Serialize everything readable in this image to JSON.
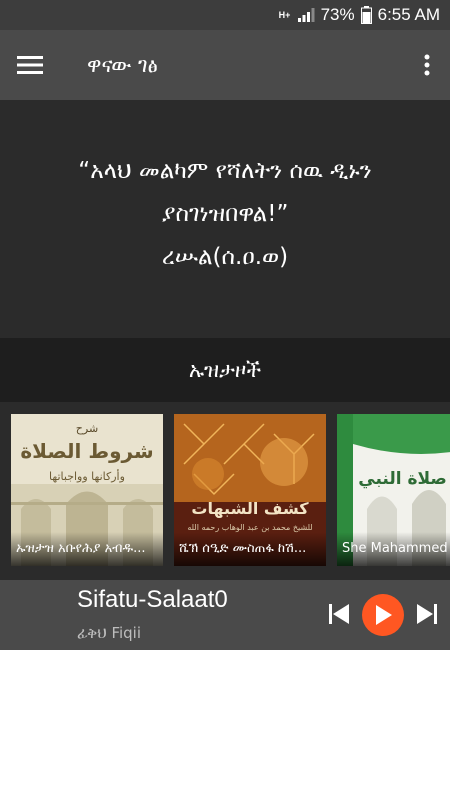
{
  "status_bar": {
    "network_type": "H+",
    "network_indicator": "4G",
    "battery": "73%",
    "time": "6:55 AM",
    "icons": [
      "signal-icon",
      "battery-icon"
    ]
  },
  "app_bar": {
    "title": "ዋናው ገፅ",
    "menu_icon": "hamburger-menu-icon",
    "more_icon": "more-vert-icon"
  },
  "quote": {
    "line1": "“አላህ መልካም የሻለትን ሰዉ ዲኑን",
    "line2": "ያስገነዝበዋል!”",
    "line3": "ረሡል(ሰ.ዐ.ወ)"
  },
  "section": {
    "title": "ኡዝታዞች"
  },
  "albums": [
    {
      "label": "ኡዝታዝ አቡየሕያ አብዱ..."
    },
    {
      "label": "ሼኽ ሰዒድ ሙስጠፋ ከሽ..."
    },
    {
      "label": "She Mahammed"
    }
  ],
  "album_art_text": {
    "a1_top": "شرح",
    "a1_main": "شروط الصلاة",
    "a1_sub": "وأركانها وواجباتها",
    "a2_title": "كشف الشبهات",
    "a2_author": "للشيخ محمد بن عبد الوهاب رحمه الله",
    "a3_title": "صفة صلاة النبي"
  },
  "player": {
    "title": "Sifatu-Salaat0",
    "subtitle": "ፊቅህ Fiqii",
    "icons": [
      "skip-previous-icon",
      "play-icon",
      "skip-next-icon"
    ],
    "accent_color": "#ff5722"
  },
  "colors": {
    "status_bar": "#3d3d3d",
    "app_bar": "#4a4a4a",
    "panel": "#2b2b2b",
    "section_header": "#1e1e1e",
    "accent": "#ff5722"
  }
}
